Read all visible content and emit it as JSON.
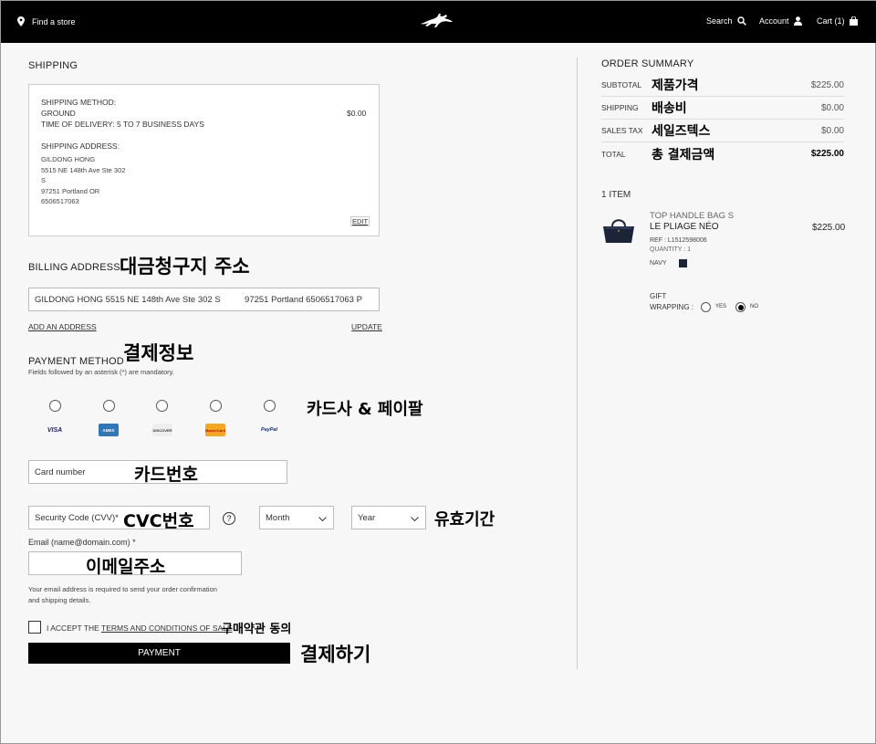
{
  "topbar": {
    "find_store": "Find a store",
    "search": "Search",
    "account": "Account",
    "cart": "Cart (1)"
  },
  "shipping": {
    "title": "SHIPPING",
    "method_label": "SHIPPING METHOD:",
    "method": "GROUND",
    "price": "$0.00",
    "delivery": "TIME OF DELIVERY: 5 TO 7 BUSINESS DAYS",
    "address_label": "SHIPPING ADDRESS:",
    "address_lines": [
      "GILDONG HONG",
      "5515 NE 148th Ave Ste 302",
      "S",
      "97251 Portland OR",
      "6506517063"
    ],
    "edit": "EDIT"
  },
  "billing": {
    "title": "BILLING ADDRESS",
    "annotation": "대금청구지 주소",
    "value": "GILDONG HONG 5515 NE 148th Ave Ste 302 S          97251 Portland 6506517063 P",
    "add_address": "ADD AN ADDRESS",
    "update": "UPDATE"
  },
  "payment": {
    "title": "PAYMENT METHOD",
    "annotation": "결제정보",
    "mandatory_note": "Fields followed by an asterisk (*) are mandatory.",
    "cards": [
      {
        "name": "VISA",
        "color": "#1a1f71"
      },
      {
        "name": "AMEX",
        "color": "#2e77bb"
      },
      {
        "name": "DISCOVER",
        "color": "#f58220"
      },
      {
        "name": "MasterCard",
        "color": "#eb001b"
      },
      {
        "name": "PayPal",
        "color": "#003087"
      }
    ],
    "cards_annotation": "카드사 & 페이팔",
    "card_number_placeholder": "Card number",
    "card_number_annotation": "카드번호",
    "cvv_placeholder": "Security Code (CVV)*",
    "cvv_annotation": "CVC번호",
    "help_icon": "?",
    "month": "Month",
    "year": "Year",
    "expiry_annotation": "유효기간",
    "email_label": "Email (name@domain.com) *",
    "email_annotation": "이메일주소",
    "email_note_1": "Your email address is required to send your order confirmation",
    "email_note_2": "and shipping details.",
    "accept_prefix": "I ACCEPT THE",
    "accept_link": "TERMS AND CONDITIONS OF SALE",
    "accept_annotation": "구매약관 동의",
    "pay_button": "PAYMENT",
    "pay_annotation": "결제하기"
  },
  "summary": {
    "title": "ORDER SUMMARY",
    "rows": [
      {
        "label": "SUBTOTAL",
        "annotation": "제품가격",
        "value": "$225.00"
      },
      {
        "label": "SHIPPING",
        "annotation": "배송비",
        "value": "$0.00"
      },
      {
        "label": "SALES TAX",
        "annotation": "세일즈텍스",
        "value": "$0.00"
      },
      {
        "label": "TOTAL",
        "annotation": "총 결제금액",
        "value": "$225.00"
      }
    ],
    "items_count": "1 ITEM",
    "item": {
      "category": "TOP HANDLE BAG S",
      "name": "LE PLIAGE NÉO",
      "price": "$225.00",
      "ref": "REF : L1512598006",
      "quantity": "QUANTITY : 1",
      "color": "NAVY",
      "color_hex": "#1c2538"
    },
    "gift": "GIFT",
    "wrapping": "WRAPPING :",
    "yes": "YES",
    "no": "NO"
  }
}
